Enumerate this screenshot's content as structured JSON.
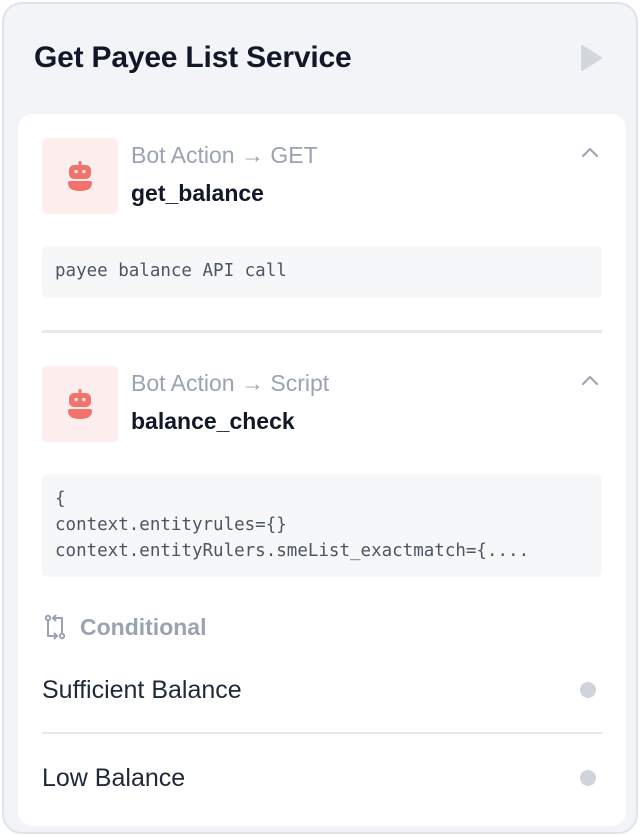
{
  "header": {
    "title": "Get Payee List Service"
  },
  "actions": [
    {
      "type": "Bot Action → GET",
      "name": "get_balance",
      "code": "payee balance API call"
    },
    {
      "type": "Bot Action → Script",
      "name": "balance_check",
      "code": "{\ncontext.entityrules={}\ncontext.entityRulers.smeList_exactmatch={...."
    }
  ],
  "conditional": {
    "label": "Conditional",
    "branches": [
      {
        "label": "Sufficient Balance"
      },
      {
        "label": "Low Balance"
      }
    ]
  },
  "colors": {
    "accent_bot": "#f2736b",
    "bot_tile_bg": "#fdeeee",
    "muted_text": "#9aa3b2"
  },
  "icons": {
    "run": "play-icon",
    "bot": "robot-icon",
    "collapse": "chevron-up-icon",
    "conditional": "branch-icon"
  }
}
